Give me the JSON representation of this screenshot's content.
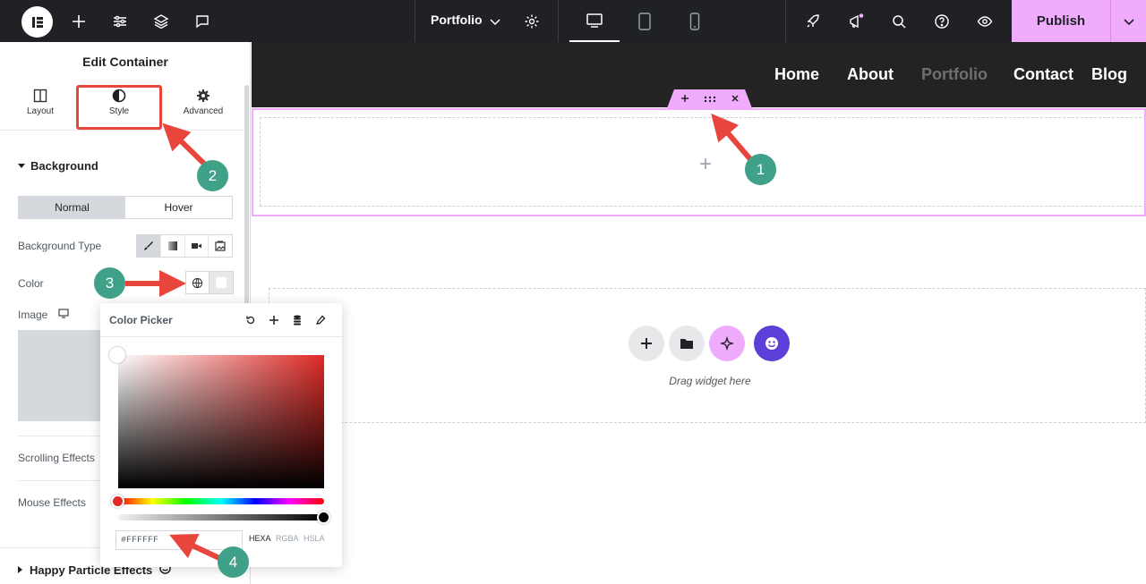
{
  "topbar": {
    "page_title": "Portfolio",
    "publish_label": "Publish"
  },
  "panel": {
    "title": "Edit Container",
    "tabs": [
      {
        "label": "Layout"
      },
      {
        "label": "Style"
      },
      {
        "label": "Advanced"
      }
    ],
    "background_section": "Background",
    "state_tabs": [
      "Normal",
      "Hover"
    ],
    "background_type_label": "Background Type",
    "color_label": "Color",
    "image_label": "Image",
    "scrolling_effects_label": "Scrolling Effects",
    "mouse_effects_label": "Mouse Effects",
    "happy_particle_label": "Happy Particle Effects"
  },
  "color_picker": {
    "title": "Color Picker",
    "hex_value": "#FFFFFF",
    "formats": [
      "HEXA",
      "RGBA",
      "HSLA"
    ],
    "active_format": "HEXA"
  },
  "site": {
    "nav": [
      "Home",
      "About",
      "Portfolio",
      "Contact",
      "Blog"
    ],
    "active_nav": "Portfolio",
    "drag_text": "Drag widget here"
  },
  "annotations": [
    "1",
    "2",
    "3",
    "4"
  ],
  "colors": {
    "accent_pink": "#f0abfc",
    "arrow_red": "#e8453c",
    "badge_green": "#3fa187",
    "dark_bar": "#1f2124",
    "purple_btn": "#5b3fd6"
  }
}
